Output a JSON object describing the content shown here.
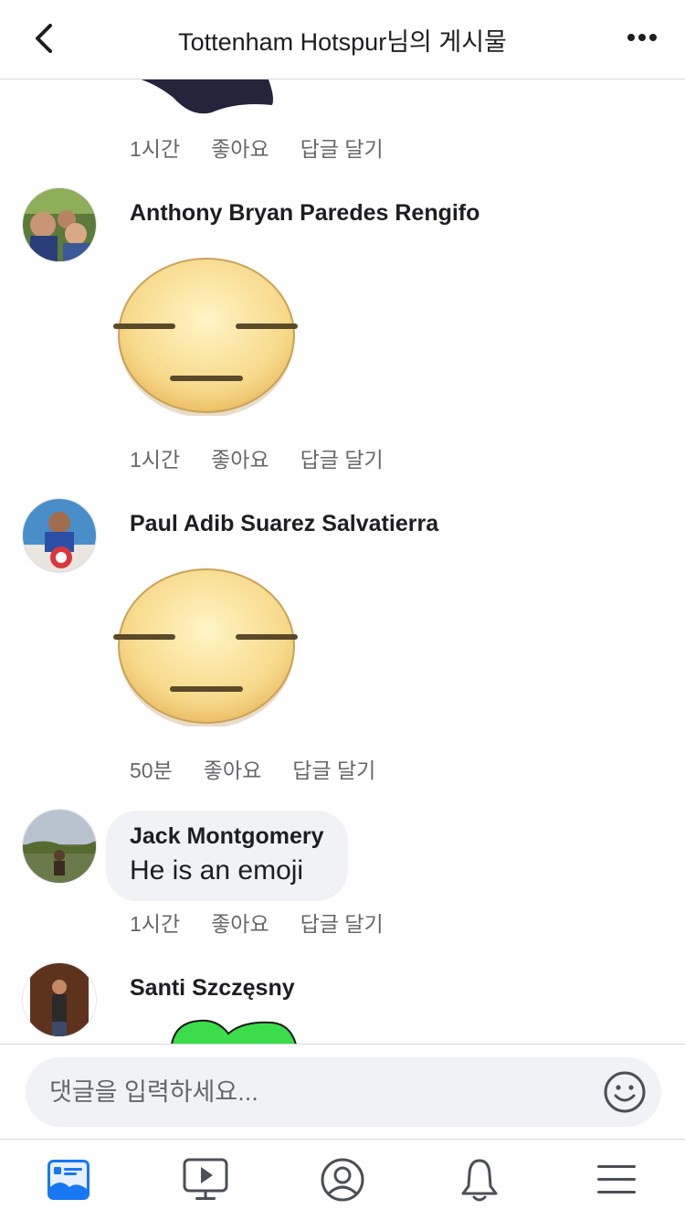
{
  "header": {
    "title": "Tottenham Hotspur님의 게시물",
    "back_icon": "chevron-left-icon",
    "more_icon": "more-dots-icon"
  },
  "comments": [
    {
      "type": "sticker-partial",
      "time": "1시간",
      "like": "좋아요",
      "reply": "답글 달기"
    },
    {
      "type": "sticker",
      "author": "Anthony Bryan Paredes Rengifo",
      "time": "1시간",
      "like": "좋아요",
      "reply": "답글 달기"
    },
    {
      "type": "sticker",
      "author": "Paul Adib Suarez Salvatierra",
      "time": "50분",
      "like": "좋아요",
      "reply": "답글 달기"
    },
    {
      "type": "text",
      "author": "Jack Montgomery",
      "text": "He is an emoji",
      "time": "1시간",
      "like": "좋아요",
      "reply": "답글 달기"
    },
    {
      "type": "sticker-partial",
      "author": "Santi Szczęsny"
    }
  ],
  "composer": {
    "placeholder": "댓글을 입력하세요...",
    "emoji_icon": "smiley-icon"
  },
  "tabbar": {
    "items": [
      "news-feed-icon",
      "watch-icon",
      "profile-icon",
      "notifications-icon",
      "menu-icon"
    ],
    "active_color": "#1877f2",
    "inactive_color": "#65676b"
  }
}
